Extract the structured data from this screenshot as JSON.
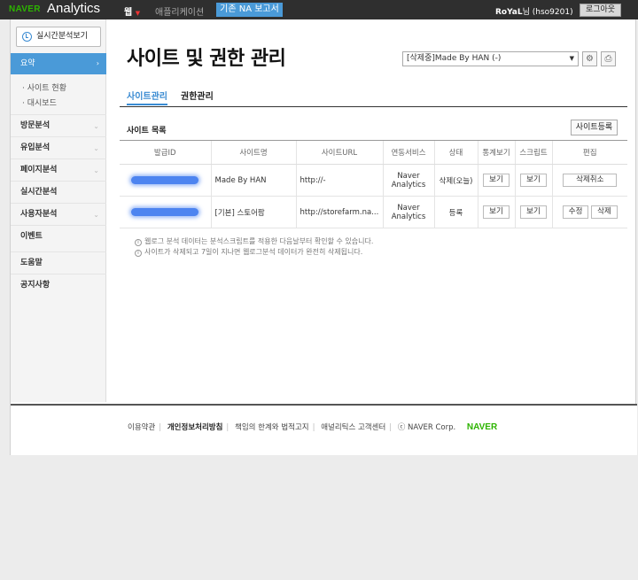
{
  "topbar": {
    "logo_naver": "NAVER",
    "logo_analytics": "Analytics",
    "nav_web": "웹",
    "nav_app": "애플리케이션",
    "nav_old_report": "기존 NA 보고서",
    "user_name": "RoYaL",
    "user_suffix": "님 (hso9201)",
    "logout": "로그아웃"
  },
  "sidebar": {
    "realtime_button": "실시간분석보기",
    "active_item": "요약",
    "sub_items": [
      "사이트 현황",
      "대시보드"
    ],
    "items": [
      "방문분석",
      "유입분석",
      "페이지분석",
      "실시간분석",
      "사용자분석",
      "이벤트",
      "도움말",
      "공지사항"
    ]
  },
  "main": {
    "title": "사이트 및 권한 관리",
    "site_select": "[삭제중]Made By HAN (-)",
    "tabs": [
      "사이트관리",
      "권한관리"
    ],
    "list_title": "사이트 목록",
    "register_button": "사이트등록",
    "columns": [
      "발급ID",
      "사이트명",
      "사이트URL",
      "연동서비스",
      "상태",
      "통계보기",
      "스크립트",
      "편집"
    ],
    "rows": [
      {
        "site_name": "Made By HAN",
        "url": "http://-",
        "service": "Naver Analytics",
        "status": "삭제(오늘)",
        "stats": "보기",
        "script": "보기",
        "edit": [
          "삭제취소"
        ]
      },
      {
        "site_name": "[기본] 스토어팜",
        "url": "http://storefarm.na...",
        "service": "Naver Analytics",
        "status": "등록",
        "stats": "보기",
        "script": "보기",
        "edit": [
          "수정",
          "삭제"
        ]
      }
    ],
    "notes": [
      "웹로그 분석 데이터는 분석스크립트를 적용한 다음날부터 확인할 수 있습니다.",
      "사이트가 삭제되고 7일이 지나면 웹로그분석 데이터가 완전히 삭제됩니다."
    ]
  },
  "footer": {
    "links": [
      "이용약관",
      "개인정보처리방침",
      "책임의 한계와 법적고지",
      "애널리틱스 고객센터"
    ],
    "copyright": "ⓒ NAVER Corp.",
    "brand": "NAVER"
  },
  "colors": {
    "accent": "#4a9ad8",
    "naver_green": "#2db400",
    "topbar": "#2f2f2f"
  }
}
